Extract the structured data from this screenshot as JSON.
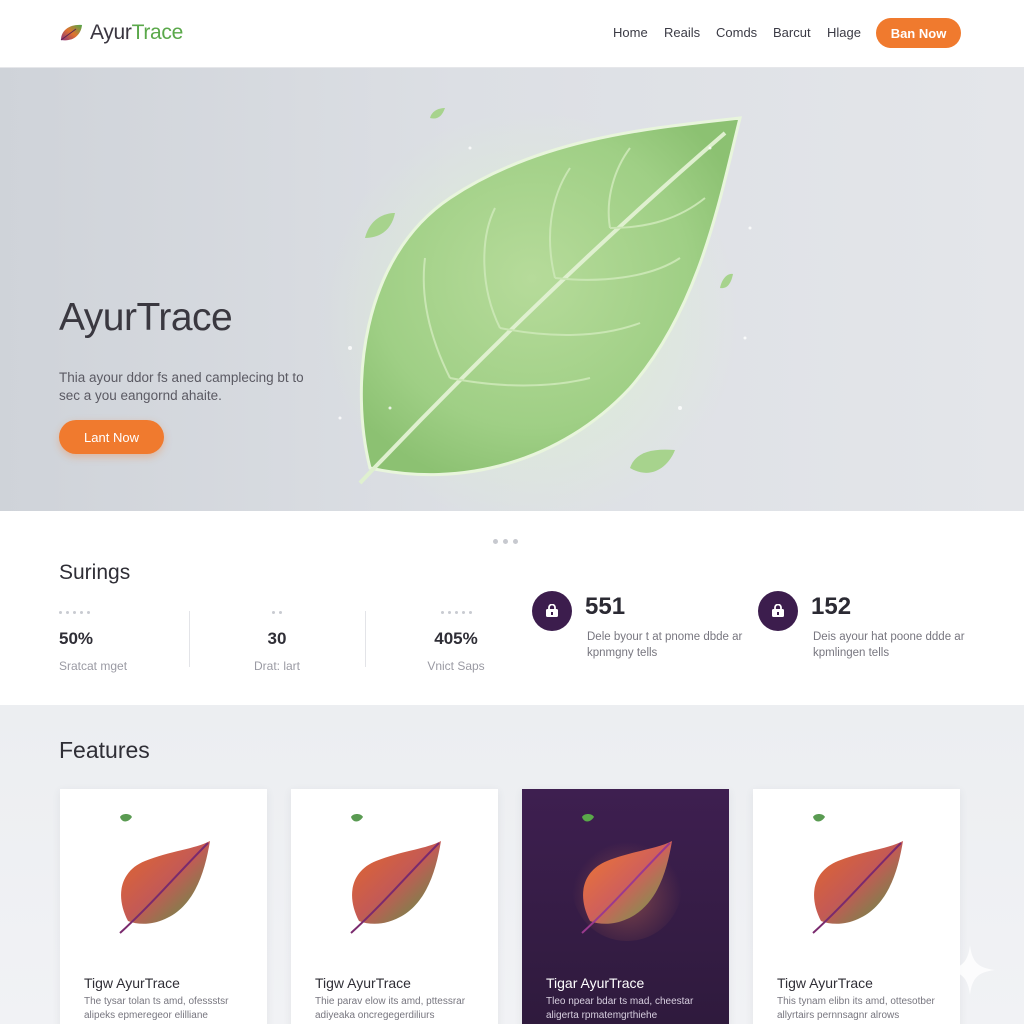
{
  "brand": {
    "name_part1": "Ayur",
    "name_part2": "Trace",
    "logo_icon": "leaf-logo-icon"
  },
  "nav": {
    "links": [
      "Home",
      "Reails",
      "Comds",
      "Barcut",
      "Hlage"
    ],
    "cta_label": "Ban Now"
  },
  "hero": {
    "title": "AyurTrace",
    "subtitle": "Thia ayour ddor fs aned camplecing bt to sec a you eangornd ahaite.",
    "cta_label": "Lant Now",
    "art_icon": "glowing-leaf-illustration"
  },
  "stats": {
    "title": "Surings",
    "items": [
      {
        "value": "50%",
        "label": "Sratcat mget"
      },
      {
        "value": "30",
        "label": "Drat: lart"
      },
      {
        "value": "405%",
        "label": "Vnict Saps"
      }
    ],
    "metrics": [
      {
        "value": "551",
        "description": "Dele byour t at pnome dbde ar kpnmgny tells",
        "icon": "lock-icon"
      },
      {
        "value": "152",
        "description": "Deis ayour hat poone ddde ar kpmlingen tells",
        "icon": "lock-icon"
      }
    ]
  },
  "features": {
    "title": "Features",
    "cards": [
      {
        "title": "Tigw AyurTrace",
        "description": "The tysar tolan ts amd, ofessstsr alipeks epmeregeor elilliane",
        "theme": "light"
      },
      {
        "title": "Tigw AyurTrace",
        "description": "Thie parav elow its amd, pttessrar adiyeaka oncregegerdiliurs",
        "theme": "light"
      },
      {
        "title": "Tigar AyurTrace",
        "description": "Tleo npear bdar ts mad, cheestar aligerta rpmatemgrthiehe",
        "theme": "dark"
      },
      {
        "title": "Tigw AyurTrace",
        "description": "This tynam elibn its amd, ottesotber allyrtairs pernnsagnr alrows",
        "theme": "light"
      }
    ]
  },
  "colors": {
    "accent": "#f07a2e",
    "brand_green": "#5aa84a",
    "dark_purple": "#3c1d4d"
  }
}
